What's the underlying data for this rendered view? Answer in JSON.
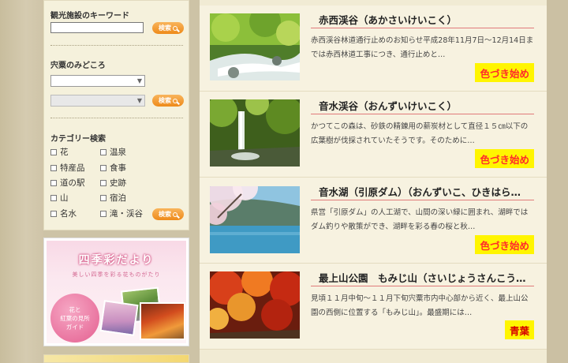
{
  "sidebar": {
    "keyword_heading": "観光施設のキーワード",
    "keyword_value": "",
    "search_label": "検索",
    "highlights_heading": "宍粟のみどころ",
    "select1_value": "",
    "select2_value": "",
    "category_heading": "カテゴリー検索",
    "categories": [
      "花",
      "温泉",
      "特産品",
      "食事",
      "道の駅",
      "史跡",
      "山",
      "宿泊",
      "名水",
      "滝・渓谷"
    ]
  },
  "banner": {
    "title": "四季彩だより",
    "subtitle": "美しい四季を彩る花ものがたり",
    "circle_line1": "花と",
    "circle_line2": "紅葉の見所",
    "circle_line3": "ガイド"
  },
  "items": [
    {
      "title": "赤西渓谷（あかさいけいこく）",
      "desc": "赤西渓谷林道通行止めのお知らせ平成28年11月7日～12月14日までは赤西林道工事につき、通行止めと…",
      "status": "色づき始め"
    },
    {
      "title": "音水渓谷（おんずいけいこく）",
      "desc": "かつてこの森は、砂鉄の精錬用の薪炭材として直径１５㎝以下の広葉樹が伐採されていたそうです。そのために…",
      "status": "色づき始め"
    },
    {
      "title": "音水湖（引原ダム）（おんずいこ、ひきはら…",
      "desc": "県営「引原ダム」の人工湖で、山間の深い緑に囲まれ、湖畔ではダム釣りや散策ができ、湖畔を彩る春の桜と秋…",
      "status": "色づき始め"
    },
    {
      "title": "最上山公園　もみじ山（さいじょうさんこう…",
      "desc": "見頃１１月中旬～１１月下旬宍粟市内中心部から近く、最上山公園の西側に位置する「もみじ山」。最盛期には…",
      "status": "青葉"
    }
  ]
}
